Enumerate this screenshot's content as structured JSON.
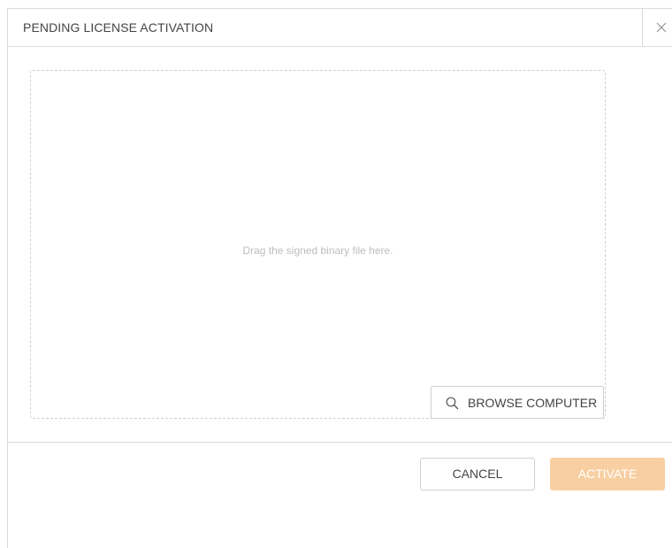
{
  "dialog": {
    "title": "PENDING LICENSE ACTIVATION",
    "close_icon": "close-icon"
  },
  "dropzone": {
    "hint": "Drag the signed binary file here.",
    "browse_label": "BROWSE COMPUTER",
    "browse_icon": "search-icon"
  },
  "footer": {
    "cancel_label": "CANCEL",
    "activate_label": "ACTIVATE",
    "activate_disabled": true
  },
  "colors": {
    "accent_disabled": "#f8cfa2",
    "border": "#d9d9d9",
    "text": "#444444",
    "hint_text": "#bdbdbd"
  }
}
